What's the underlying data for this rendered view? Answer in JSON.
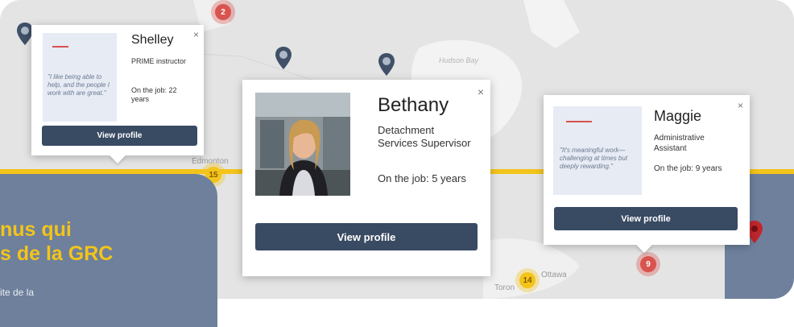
{
  "map": {
    "labels": {
      "hudson_bay": "Hudson Bay",
      "edmonton": "Edmonton",
      "ottawa": "Ottawa",
      "toronto": "Toron"
    },
    "clusters": {
      "top": "2",
      "edmonton": "15",
      "ottawa": "14",
      "east": "9"
    }
  },
  "cards": {
    "shelley": {
      "name": "Shelley",
      "role": "PRIME instructor",
      "tenure": "On the job: 22 years",
      "quote": "\"I like being able to help, and the people I work with are great.\"",
      "button": "View profile",
      "close": "×"
    },
    "bethany": {
      "name": "Bethany",
      "role": "Detachment Services Supervisor",
      "tenure": "On the job: 5 years",
      "button": "View profile",
      "close": "×"
    },
    "maggie": {
      "name": "Maggie",
      "role": "Administrative Assistant",
      "tenure": "On the job: 9 years",
      "quote": "\"It's meaningful work—challenging at times but deeply rewarding.\"",
      "button": "View profile",
      "close": "×"
    }
  },
  "overlay": {
    "title_line1": "nus qui",
    "title_line2": "s de la GRC",
    "subtitle": "ite de la"
  },
  "colors": {
    "accent_yellow": "#f3c41a",
    "panel_blue": "#6e809c",
    "button_navy": "#394a63",
    "cluster_red": "#d9534f"
  }
}
